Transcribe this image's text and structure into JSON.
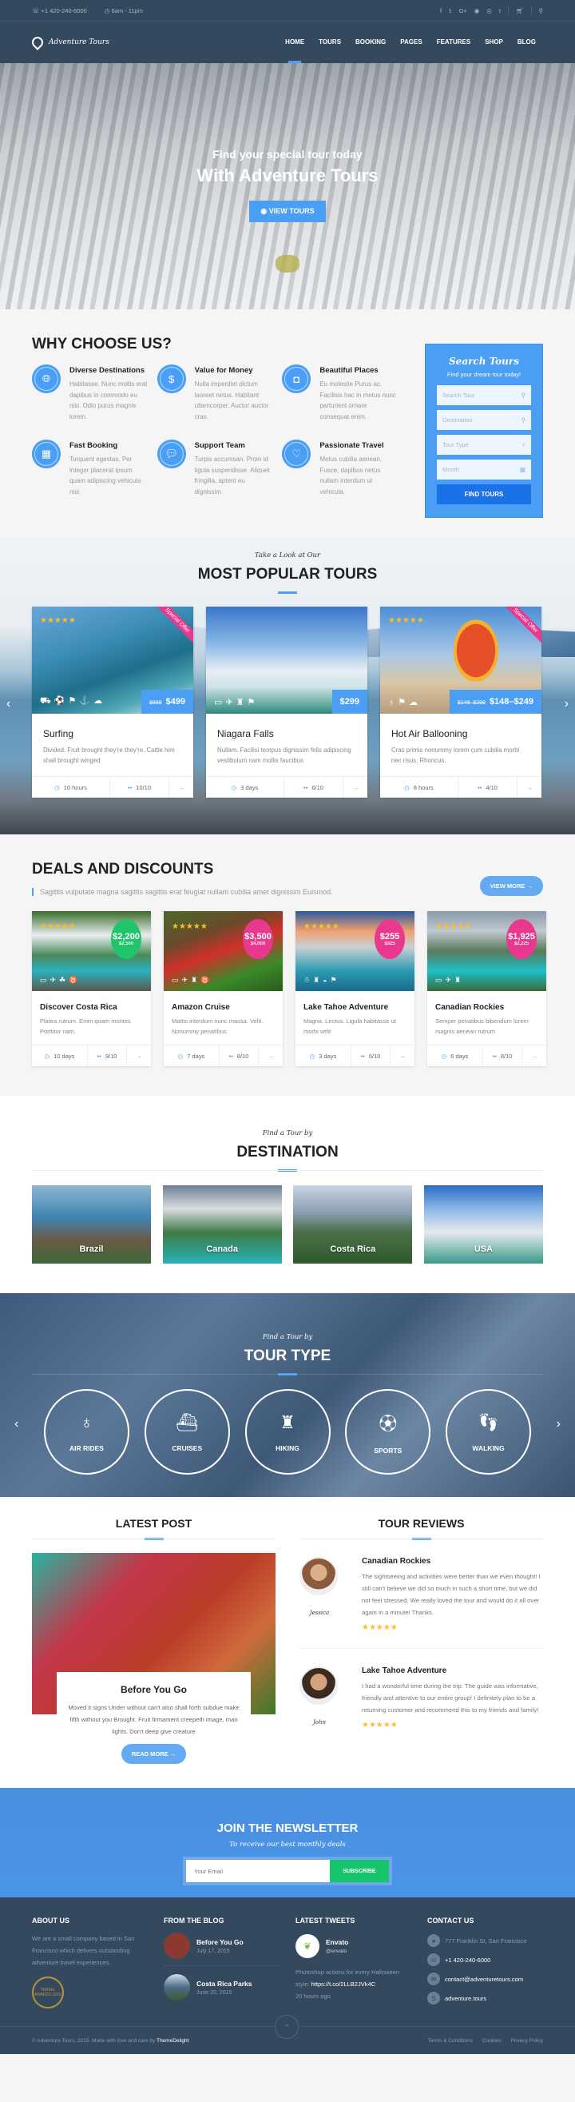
{
  "topbar": {
    "phone": "+1 420-240-6000",
    "hours": "6am - 11pm",
    "social": [
      "f",
      "t",
      "G+",
      "p",
      "i",
      "t"
    ]
  },
  "header": {
    "logo": "Adventure Tours",
    "nav": [
      "HOME",
      "TOURS",
      "BOOKING",
      "PAGES",
      "FEATURES",
      "SHOP",
      "BLOG"
    ],
    "active": "HOME"
  },
  "hero": {
    "subtitle": "Find your special tour today",
    "title": "With Adventure Tours",
    "button": "VIEW TOURS"
  },
  "why": {
    "title": "WHY CHOOSE US?",
    "features": [
      {
        "icon": "globe-icon",
        "title": "Diverse Destinations",
        "text": "Habitasse. Nunc mollis erat dapibus in commodo eu nisi. Odio purus magnis lorem."
      },
      {
        "icon": "money-icon",
        "title": "Value for Money",
        "text": "Nulla imperdiet dictum laoreet netus. Habitant ullamcorper. Auctor auctor cras."
      },
      {
        "icon": "camera-icon",
        "title": "Beautiful Places",
        "text": "Eu molestie Purus ac. Facilisis hac in metus nunc parturient ornare consequat enim."
      },
      {
        "icon": "calendar-icon",
        "title": "Fast Booking",
        "text": "Torquent egestas. Per integer placerat ipsum quam adipiscing vehicula nisi."
      },
      {
        "icon": "chat-icon",
        "title": "Support Team",
        "text": "Turpis accumsan. Proin id ligula suspendisse. Aliquet fringilla, aptent eu dignissim."
      },
      {
        "icon": "heart-icon",
        "title": "Passionate Travel",
        "text": "Metus cubilia aenean. Fusce, dapibus netus nullam interdum ut vehicula."
      }
    ]
  },
  "search": {
    "title": "Search Tours",
    "subtitle": "Find your dream tour today!",
    "fields": [
      "Search Tour",
      "Destination",
      "Tour Type",
      "Month"
    ],
    "button": "FIND TOURS"
  },
  "popular": {
    "script": "Take a Look at Our",
    "title": "MOST POPULAR TOURS",
    "cards": [
      {
        "title": "Surfing",
        "text": "Divided. Fruit brought they're they're. Cattle him shall brought winged",
        "old_price": "$899",
        "price": "$499",
        "ribbon": "Special Offer",
        "duration": "10 hours",
        "rating": "10/10",
        "stars": "★★★★★"
      },
      {
        "title": "Niagara Falls",
        "text": "Nullam. Facilisi tempus dignissim felis adipiscing vestibulum nam mollis faucibus",
        "old_price": "",
        "price": "$299",
        "ribbon": "",
        "duration": "3 days",
        "rating": "6/10",
        "stars": ""
      },
      {
        "title": "Hot Air Ballooning",
        "text": "Cras primis nonummy lorem cum cubilia morbi nec risus. Rhoncus.",
        "old_price": "$148–$299",
        "price": "$148–$249",
        "ribbon": "Special Offer",
        "duration": "8 hours",
        "rating": "4/10",
        "stars": "★★★★★"
      }
    ]
  },
  "deals": {
    "title": "DEALS AND DISCOUNTS",
    "desc": "Sagittis vulputate magna sagittis sagittis erat feugiat nullam cubilia amet dignissim Euismod.",
    "button": "VIEW MORE →",
    "cards": [
      {
        "title": "Discover Costa Rica",
        "text": "Platea rutrum. Enim quam montes Porttitor nam,",
        "price": "$2,200",
        "old": "$2,500",
        "duration": "10 days",
        "rating": "9/10",
        "badge_color": "#20c56b"
      },
      {
        "title": "Amazon Cruise",
        "text": "Mattis interdum nunc massa. Velit. Nonummy penatibus",
        "price": "$3,500",
        "old": "$4,000",
        "duration": "7 days",
        "rating": "8/10",
        "badge_color": "#e8398f"
      },
      {
        "title": "Lake Tahoe Adventure",
        "text": "Magna. Lectus. Ligula habitasse ut morbi velit",
        "price": "$255",
        "old": "$325",
        "duration": "3 days",
        "rating": "6/10",
        "badge_color": "#e8398f"
      },
      {
        "title": "Canadian Rockies",
        "text": "Semper penatibus bibendum lorem magnis aenean rutrum",
        "price": "$1,925",
        "old": "$2,225",
        "duration": "6 days",
        "rating": "8/10",
        "badge_color": "#e8398f"
      }
    ]
  },
  "destination": {
    "script": "Find a Tour by",
    "title": "DESTINATION",
    "items": [
      "Brazil",
      "Canada",
      "Costa Rica",
      "USA"
    ]
  },
  "tourtype": {
    "script": "Find a Tour by",
    "title": "TOUR TYPE",
    "items": [
      "AIR RIDES",
      "CRUISES",
      "HIKING",
      "SPORTS",
      "WALKING"
    ]
  },
  "post": {
    "heading": "LATEST POST",
    "title": "Before You Go",
    "text": "Moved it signs Under without can't also shall forth subdue make fifth without you Brought. Fruit firmament creepeth image, man lights. Don't deep give creature",
    "button": "READ MORE →"
  },
  "reviews": {
    "heading": "TOUR REVIEWS",
    "items": [
      {
        "name": "Jessica",
        "title": "Canadian Rockies",
        "text": "The sightseeing and activities were better than we even thought! I still can't believe we did so much in such a short time, but we did not feel stressed. We really loved the tour and would do it all over again in a minute! Thanks.",
        "stars": "★★★★★"
      },
      {
        "name": "John",
        "title": "Lake Tahoe Adventure",
        "text": "I had a wonderful time during the trip. The guide was informative, friendly and attentive to our entire group! I definitely plan to be a returning customer and recommend this to my friends and family!",
        "stars": "★★★★★"
      }
    ]
  },
  "newsletter": {
    "title": "JOIN THE NEWSLETTER",
    "script": "To receive our best monthly deals",
    "placeholder": "Your Email",
    "button": "SUBSCRIBE"
  },
  "footer": {
    "about_title": "ABOUT US",
    "about_text": "We are a small company based in San Francisco which delivers outstanding adventure travel experiences.",
    "award": "TRAVEL AWARDS 2015",
    "blog_title": "FROM THE BLOG",
    "blog": [
      {
        "title": "Before You Go",
        "date": "July 17, 2015"
      },
      {
        "title": "Costa Rica Parks",
        "date": "June 20, 2015"
      }
    ],
    "tweets_title": "LATEST TWEETS",
    "tweet": {
      "name": "Envato",
      "handle": "@envato",
      "text": "Photoshop actions for every Halloween style:",
      "link": "https://t.co/2LLB2JVk4C",
      "time": "20 hours ago"
    },
    "contact_title": "CONTACT US",
    "contact": [
      "777 Franklin St, San Francisco",
      "+1 420-240-6000",
      "contact@adventuretours.com",
      "adventure.tours"
    ],
    "copyright": "© Adventure Tours, 2015. Made with love and care by",
    "brand": "ThemeDelight",
    "links": [
      "Terms & Conditions",
      "Cookies",
      "Privacy Policy"
    ]
  }
}
